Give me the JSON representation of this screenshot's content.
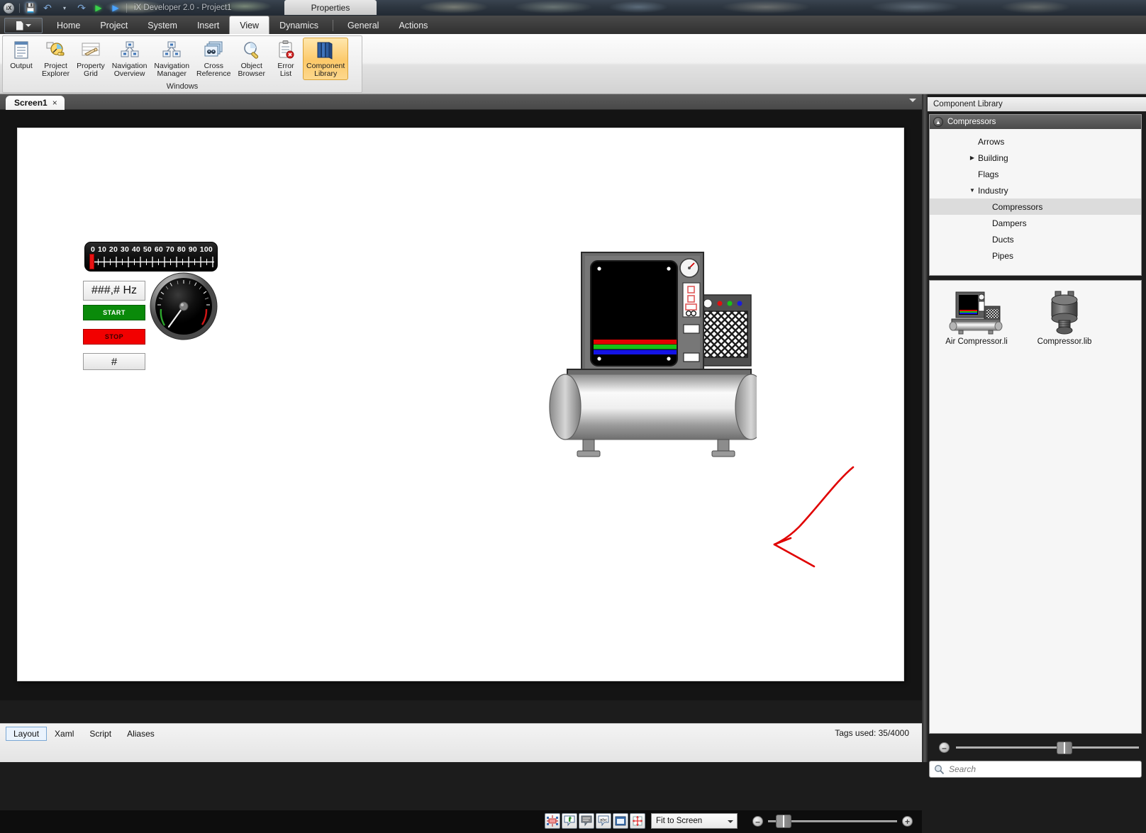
{
  "titlebar": {
    "app_title": "iX Developer 2.0 - Project1",
    "orb_label": "iX",
    "properties_tab": "Properties",
    "quick_access": [
      {
        "name": "save-icon",
        "glyph": "💾"
      },
      {
        "name": "undo-icon",
        "glyph": "↶"
      },
      {
        "name": "undo-dropdown-icon",
        "glyph": "▾"
      },
      {
        "name": "redo-icon",
        "glyph": "↷"
      },
      {
        "name": "run-icon",
        "glyph": "▶"
      },
      {
        "name": "download-icon",
        "glyph": "▶"
      }
    ]
  },
  "ribbon": {
    "file_button": "File",
    "tabs": [
      {
        "label": "Home",
        "active": false
      },
      {
        "label": "Project",
        "active": false
      },
      {
        "label": "System",
        "active": false
      },
      {
        "label": "Insert",
        "active": false
      },
      {
        "label": "View",
        "active": true
      },
      {
        "label": "Dynamics",
        "active": false
      },
      {
        "label": "General",
        "active": false
      },
      {
        "label": "Actions",
        "active": false
      }
    ],
    "group_title": "Windows",
    "buttons": [
      {
        "label": "Output",
        "icon": "output-icon",
        "active": false
      },
      {
        "label": "Project\nExplorer",
        "icon": "project-explorer-icon",
        "active": false
      },
      {
        "label": "Property\nGrid",
        "icon": "property-grid-icon",
        "active": false
      },
      {
        "label": "Navigation\nOverview",
        "icon": "navigation-overview-icon",
        "active": false
      },
      {
        "label": "Navigation\nManager",
        "icon": "navigation-manager-icon",
        "active": false
      },
      {
        "label": "Cross\nReference",
        "icon": "cross-reference-icon",
        "active": false
      },
      {
        "label": "Object\nBrowser",
        "icon": "object-browser-icon",
        "active": false
      },
      {
        "label": "Error\nList",
        "icon": "error-list-icon",
        "active": false
      },
      {
        "label": "Component\nLibrary",
        "icon": "component-library-icon",
        "active": true
      }
    ]
  },
  "doc_tabs": {
    "screen1_label": "Screen1",
    "close_glyph": "×"
  },
  "canvas": {
    "meter": {
      "name": "linear-meter",
      "scale_labels": [
        "0",
        "10",
        "20",
        "30",
        "40",
        "50",
        "60",
        "70",
        "80",
        "90",
        "100"
      ],
      "value_percent": 2
    },
    "value_field": "###,# Hz",
    "start_button": "START",
    "stop_button": "STOP",
    "hash_field": "#",
    "dial": {
      "name": "round-gauge"
    },
    "compressor": {
      "name": "air-compressor-graphic"
    }
  },
  "design_bottom": {
    "view_icons": [
      {
        "name": "show-hidden-objects-icon",
        "glyph": "✣"
      },
      {
        "name": "show-tags-icon",
        "glyph": "ℹ"
      },
      {
        "name": "show-comments-icon",
        "glyph": "☰"
      },
      {
        "name": "show-texts-icon",
        "glyph": "abc"
      },
      {
        "name": "show-screen-icon",
        "glyph": "▣"
      },
      {
        "name": "show-alignment-icon",
        "glyph": "✣"
      }
    ],
    "zoom_select_value": "Fit to Screen",
    "zoom_out_glyph": "–",
    "zoom_in_glyph": "+",
    "zoom_slider_percent": 6
  },
  "statusbar": {
    "mode_tabs": [
      {
        "label": "Layout",
        "active": true
      },
      {
        "label": "Xaml",
        "active": false
      },
      {
        "label": "Script",
        "active": false
      },
      {
        "label": "Aliases",
        "active": false
      }
    ],
    "tags_used": "Tags used: 35/4000"
  },
  "component_library": {
    "panel_title": "Component Library",
    "group_title": "Compressors",
    "tree": [
      {
        "label": "Arrows",
        "twisty": "",
        "indent": 2,
        "selected": false
      },
      {
        "label": "Building",
        "twisty": "▶",
        "indent": 1,
        "selected": false
      },
      {
        "label": "Flags",
        "twisty": "",
        "indent": 2,
        "selected": false
      },
      {
        "label": "Industry",
        "twisty": "▼",
        "indent": 1,
        "selected": false
      },
      {
        "label": "Compressors",
        "twisty": "",
        "indent": 3,
        "selected": true
      },
      {
        "label": "Dampers",
        "twisty": "",
        "indent": 3,
        "selected": false
      },
      {
        "label": "Ducts",
        "twisty": "",
        "indent": 3,
        "selected": false
      },
      {
        "label": "Pipes",
        "twisty": "",
        "indent": 3,
        "selected": false
      }
    ],
    "thumbnails": [
      {
        "label": "Air Compressor.li",
        "icon": "air-compressor-thumb"
      },
      {
        "label": "Compressor.lib",
        "icon": "compressor-thumb"
      }
    ],
    "size_slider_percent": 55,
    "search_placeholder": "Search",
    "search_value": ""
  },
  "colors": {
    "accent_orange": "#fcc96a",
    "start_green": "#0a8a0a",
    "stop_red": "#f20000",
    "annotation_red": "#e00000",
    "selection_gray": "#dcdcdc"
  }
}
